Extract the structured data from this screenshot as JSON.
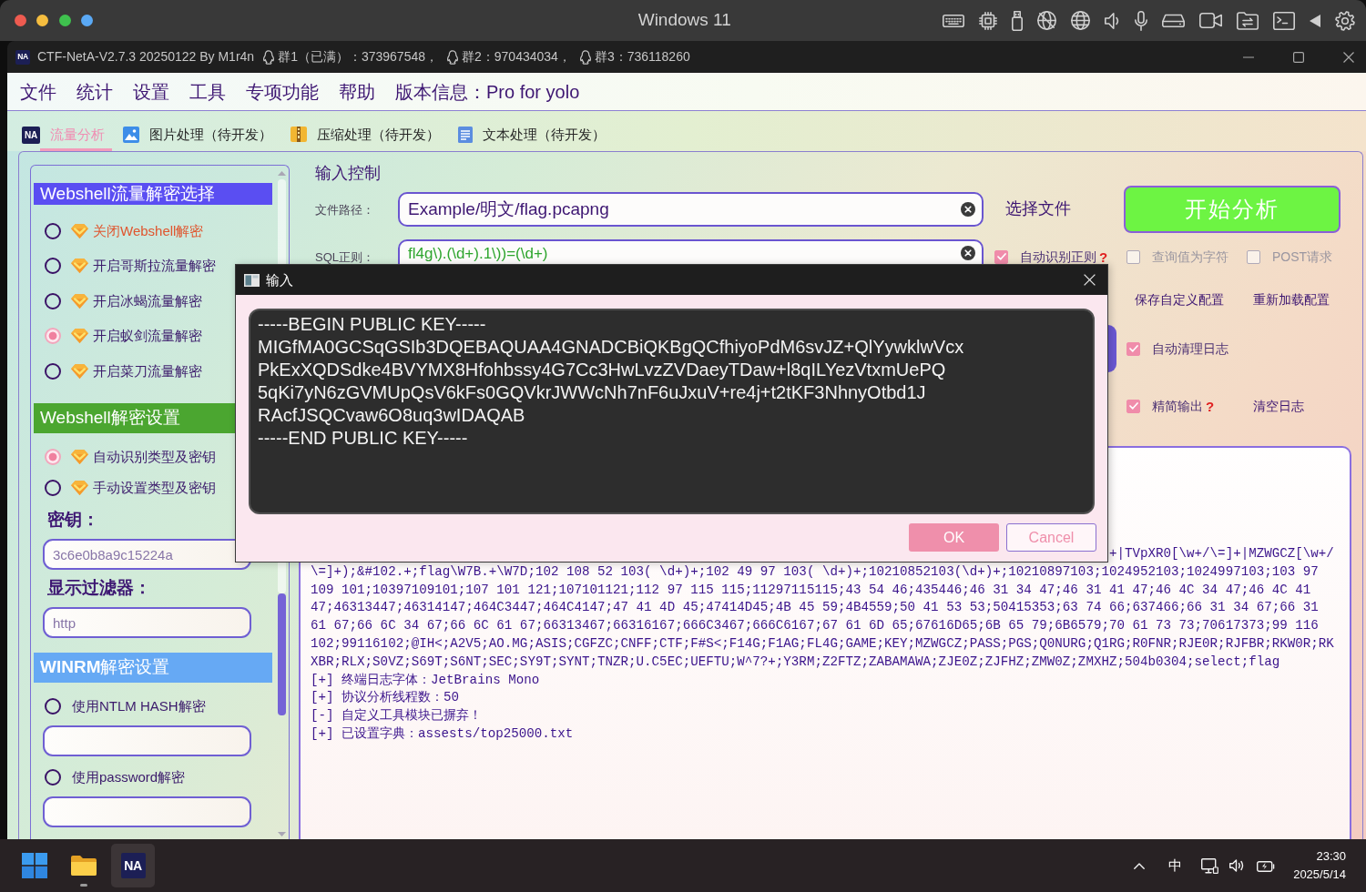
{
  "host": {
    "title": "Windows 11",
    "lights": [
      {
        "color": "#ee5b50"
      },
      {
        "color": "#f5bd3f"
      },
      {
        "color": "#3fc14e"
      },
      {
        "color": "#5aa9f5"
      }
    ]
  },
  "window": {
    "logo": "NA",
    "title": "CTF-NetA-V2.7.3 20250122 By M1r4n",
    "groups": [
      "群1（已满）：373967548，",
      "群2：970434034，",
      "群3：736118260"
    ]
  },
  "menu": [
    "文件",
    "统计",
    "设置",
    "工具",
    "专项功能",
    "帮助",
    "版本信息：Pro for yolo"
  ],
  "tabs": [
    {
      "kind": "logo",
      "logo": "NA",
      "label": "流量分析",
      "selected": true
    },
    {
      "kind": "picture",
      "label": "图片处理（待开发）",
      "selected": false
    },
    {
      "kind": "archive",
      "label": "压缩处理（待开发）",
      "selected": false
    },
    {
      "kind": "document",
      "label": "文本处理（待开发）",
      "selected": false
    }
  ],
  "sections": [
    {
      "title": "Webshell流量解密选择",
      "color": "#5a4ef2",
      "items": [
        {
          "kind": "radio",
          "label": "关闭Webshell解密",
          "gem": true,
          "highlighted": true,
          "selected": false
        },
        {
          "kind": "radio",
          "label": "开启哥斯拉流量解密",
          "gem": true,
          "highlighted": false,
          "selected": false
        },
        {
          "kind": "radio",
          "label": "开启冰蝎流量解密",
          "gem": true,
          "highlighted": false,
          "selected": false
        },
        {
          "kind": "radio",
          "label": "开启蚁剑流量解密",
          "gem": true,
          "highlighted": false,
          "selected": true
        },
        {
          "kind": "radio",
          "label": "开启菜刀流量解密",
          "gem": true,
          "highlighted": false,
          "selected": false
        }
      ]
    },
    {
      "title": "Webshell解密设置",
      "color": "#4ba630",
      "items": [
        {
          "kind": "radio",
          "label": "自动识别类型及密钥",
          "gem": true,
          "highlighted": false,
          "selected": true
        },
        {
          "kind": "radio",
          "label": "手动设置类型及密钥",
          "gem": true,
          "highlighted": false,
          "selected": false
        },
        {
          "kind": "label",
          "text": "密钥："
        },
        {
          "kind": "field",
          "placeholder": "3c6e0b8a9c15224a"
        },
        {
          "kind": "label",
          "text": "显示过滤器："
        },
        {
          "kind": "field",
          "placeholder": "http"
        }
      ]
    },
    {
      "title": "**WINRM**解密设置",
      "color": "#66a9f4",
      "items": [
        {
          "kind": "radio",
          "label": "使用NTLM HASH解密",
          "gem": false,
          "highlighted": false,
          "selected": false
        },
        {
          "kind": "field"
        },
        {
          "kind": "radio",
          "label": "使用password解密",
          "gem": false,
          "highlighted": false,
          "selected": false
        },
        {
          "kind": "field"
        }
      ]
    }
  ],
  "input_control": {
    "title": "输入控制",
    "file_label": "文件路径：",
    "file_path": "Example/明文/flag.pcapng",
    "choose_file": "选择文件",
    "start": "开始分析",
    "sql_label": "SQL正则：",
    "sql_regex": "fl4g\\).(\\d+).1\\))=(\\d+)",
    "regex_options": [
      {
        "label": "自动识别正则",
        "checked": true,
        "help": "?"
      },
      {
        "label": "查询值为字符",
        "checked": false
      },
      {
        "label": "POST请求",
        "checked": false
      }
    ],
    "config_buttons": [
      "保存自定义配置",
      "重新加载配置"
    ],
    "log_options": [
      {
        "label": "自动清理日志",
        "checked": true
      },
      {
        "label": "精简输出",
        "checked": true,
        "help": "?"
      }
    ],
    "clear_log": "清空日志"
  },
  "log": {
    "lines": [
      {
        "kind": "tail",
        "text": "+|TVpXR0[\\w+/\\=]+|MZWGCZ[\\w+/"
      },
      {
        "kind": "line",
        "text": "\\=]+);&#102.+;flag\\W7B.+\\W7D;102 108 52 103( \\d+)+;102 49 97 103( \\d+)+;10210852103(\\d+)+;10210897103;1024952103;1024997103;103 97"
      },
      {
        "kind": "line",
        "text": "109 101;10397109101;107 101 121;107101121;112 97 115 115;11297115115;43 54 46;435446;46 31 34 47;46 31 41 47;46 4C 34 47;46 4C 41"
      },
      {
        "kind": "line",
        "text": "47;46313447;46314147;464C3447;464C4147;47 41 4D 45;47414D45;4B 45 59;4B4559;50 41 53 53;50415353;63 74 66;637466;66 31 34 67;66 31"
      },
      {
        "kind": "line",
        "text": "61 67;66 6C 34 67;66 6C 61 67;66313467;66316167;666C3467;666C6167;67 61 6D 65;67616D65;6B 65 79;6B6579;70 61 73 73;70617373;99 116"
      },
      {
        "kind": "line",
        "text": "102;99116102;@IH<;A2V5;AO.MG;ASIS;CGFZC;CNFF;CTF;F#S<;F14G;F1AG;FL4G;GAME;KEY;MZWGCZ;PASS;PGS;Q0NURG;Q1RG;R0FNR;RJE0R;RJFBR;RKW0R;RK"
      },
      {
        "kind": "line",
        "text": "XBR;RLX;S0VZ;S69T;S6NT;SEC;SY9T;SYNT;TNZR;U.C5EC;UEFTU;W^7?+;Y3RM;Z2FTZ;ZABAMAWA;ZJE0Z;ZJFHZ;ZMW0Z;ZMXHZ;504b0304;select;flag"
      },
      {
        "kind": "line",
        "text": "[+] 终端日志字体：JetBrains Mono"
      },
      {
        "kind": "line",
        "text": "[+] 协议分析线程数：50"
      },
      {
        "kind": "line",
        "text": "[-] 自定义工具模块已摒弃！"
      },
      {
        "kind": "line",
        "text": "[+] 已设置字典：assests/top25000.txt"
      }
    ]
  },
  "dialog": {
    "title": "输入",
    "text": "-----BEGIN PUBLIC KEY-----\nMIGfMA0GCSqGSIb3DQEBAQUAA4GNADCBiQKBgQCfhiyoPdM6svJZ+QlYywklwVcx\nPkExXQDSdke4BVYMX8Hfohbssy4G7Cc3HwLvzZVDaeyTDaw+l8qILYezVtxmUePQ\n5qKi7yN6zGVMUpQsV6kFs0GQVkrJWWcNh7nF6uJxuV+re4j+t2tKF3NhnyOtbd1J\nRAcfJSQCvaw6O8uq3wIDAQAB\n-----END PUBLIC KEY-----",
    "buttons": [
      {
        "kind": "primary",
        "label": "OK"
      },
      {
        "kind": "secondary",
        "label": "Cancel"
      }
    ]
  },
  "taskbar": {
    "apps": [
      {
        "kind": "start",
        "indicator": false,
        "active": false
      },
      {
        "kind": "folder",
        "indicator": true,
        "active": false
      },
      {
        "kind": "logo",
        "logo": "NA",
        "indicator": false,
        "active": true
      }
    ],
    "input_method": "中",
    "time": "23:30",
    "date": "2025/5/14"
  }
}
